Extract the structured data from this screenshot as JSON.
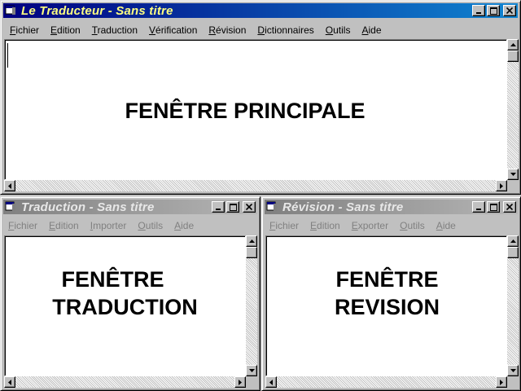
{
  "main_window": {
    "title": "Le Traducteur - Sans titre",
    "menu": [
      {
        "underline": "F",
        "rest": "ichier"
      },
      {
        "underline": "E",
        "rest": "dition"
      },
      {
        "underline": "T",
        "rest": "raduction"
      },
      {
        "underline": "V",
        "rest": "érification"
      },
      {
        "underline": "R",
        "rest": "évision"
      },
      {
        "underline": "D",
        "rest": "ictionnaires"
      },
      {
        "underline": "O",
        "rest": "utils"
      },
      {
        "underline": "A",
        "rest": "ide"
      }
    ],
    "content_text": "FENÊTRE  PRINCIPALE"
  },
  "translation_window": {
    "title": "Traduction - Sans titre",
    "menu": [
      {
        "underline": "F",
        "rest": "ichier"
      },
      {
        "underline": "E",
        "rest": "dition"
      },
      {
        "underline": "I",
        "rest": "mporter"
      },
      {
        "underline": "O",
        "rest": "utils"
      },
      {
        "underline": "A",
        "rest": "ide"
      }
    ],
    "content_line1": "FENÊTRE",
    "content_line2": "TRADUCTION"
  },
  "revision_window": {
    "title": "Révision - Sans titre",
    "menu": [
      {
        "underline": "F",
        "rest": "ichier"
      },
      {
        "underline": "E",
        "rest": "dition"
      },
      {
        "underline": "E",
        "rest": "xporter"
      },
      {
        "underline": "O",
        "rest": "utils"
      },
      {
        "underline": "A",
        "rest": "ide"
      }
    ],
    "content_line1": "FENÊTRE",
    "content_line2": "REVISION"
  },
  "colors": {
    "active_title_start": "#000080",
    "active_title_end": "#1084d0",
    "active_title_text": "#ffff80",
    "inactive_title_start": "#808080",
    "inactive_title_end": "#b5b5b5",
    "face": "#c0c0c0"
  },
  "icons": {
    "window_icon": "document-window-icon",
    "minimize": "minimize-icon",
    "maximize": "maximize-icon",
    "close": "close-icon"
  }
}
